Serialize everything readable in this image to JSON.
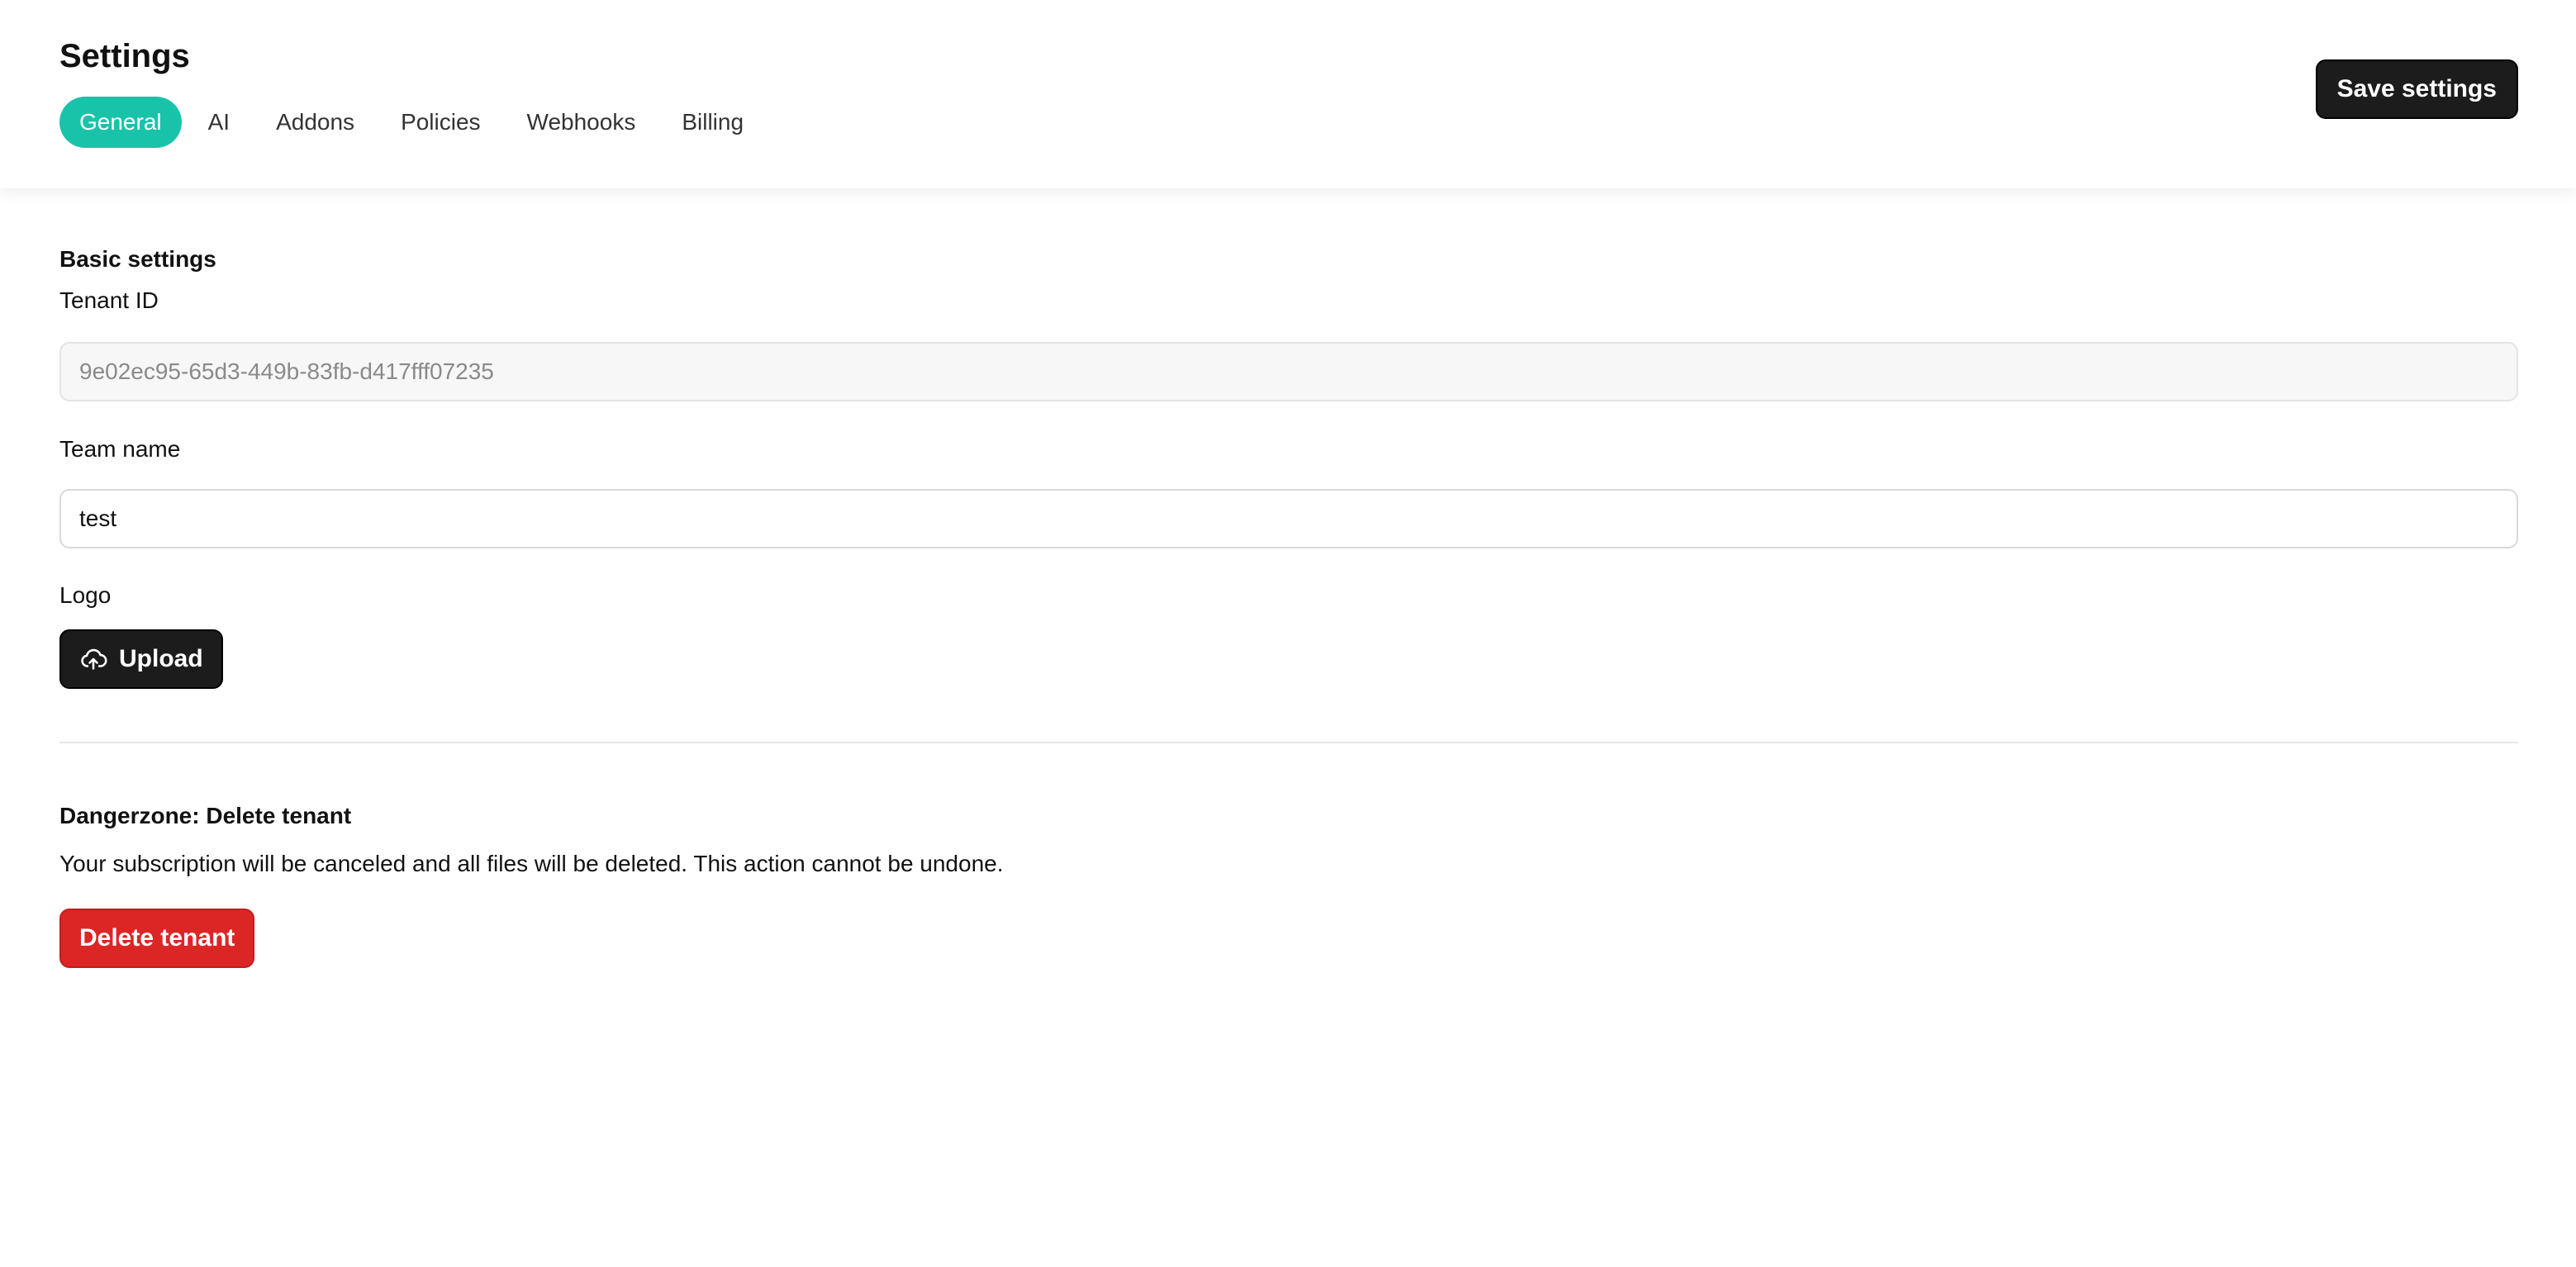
{
  "header": {
    "title": "Settings",
    "save_label": "Save settings",
    "tabs": [
      {
        "label": "General",
        "active": true
      },
      {
        "label": "AI",
        "active": false
      },
      {
        "label": "Addons",
        "active": false
      },
      {
        "label": "Policies",
        "active": false
      },
      {
        "label": "Webhooks",
        "active": false
      },
      {
        "label": "Billing",
        "active": false
      }
    ]
  },
  "basic": {
    "section_title": "Basic settings",
    "tenant_id_label": "Tenant ID",
    "tenant_id_value": "9e02ec95-65d3-449b-83fb-d417fff07235",
    "team_name_label": "Team name",
    "team_name_value": "test",
    "logo_label": "Logo",
    "upload_label": "Upload",
    "upload_icon": "cloud-upload-icon"
  },
  "danger": {
    "title": "Dangerzone: Delete tenant",
    "description": "Your subscription will be canceled and all files will be deleted. This action cannot be undone.",
    "delete_label": "Delete tenant"
  },
  "colors": {
    "accent": "#19c3aa",
    "primary_button": "#1c1c1c",
    "danger": "#dc2626"
  }
}
